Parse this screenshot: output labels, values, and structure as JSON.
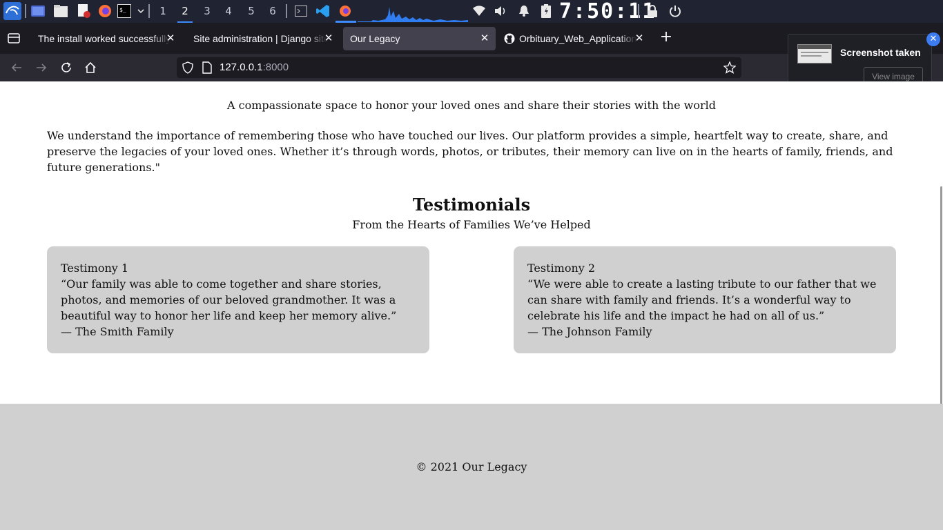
{
  "taskbar": {
    "workspaces": [
      "1",
      "2",
      "3",
      "4",
      "5",
      "6"
    ],
    "active_workspace": "2",
    "clock": "7:50:11",
    "icons": [
      "kali-menu-icon",
      "app-launcher-icon",
      "file-manager-icon",
      "text-editor-icon",
      "firefox-icon",
      "terminal-icon",
      "chevron-down-icon",
      "terminal-window-icon",
      "vscode-icon",
      "firefox-window-icon",
      "wifi-icon",
      "volume-icon",
      "bell-icon",
      "battery-icon",
      "lock-icon",
      "power-icon"
    ]
  },
  "browser": {
    "tabs": [
      {
        "label": "The install worked successfully! Congratulations!",
        "active": false
      },
      {
        "label": "Site administration | Django site admin",
        "active": false
      },
      {
        "label": "Our Legacy",
        "active": true
      },
      {
        "label": "Orbituary_Web_Application",
        "active": false
      }
    ],
    "url_host": "127.0.0.1",
    "url_port": ":8000"
  },
  "toast": {
    "title": "Screenshot taken",
    "button": "View image"
  },
  "page": {
    "tagline": "A compassionate space to honor your loved ones and share their stories with the world",
    "intro": "We understand the importance of remembering those who have touched our lives. Our platform provides a simple, heartfelt way to create, share, and preserve the legacies of your loved ones. Whether it’s through words, photos, or tributes, their memory can live on in the hearts of family, friends, and future generations.\"",
    "testimonials_title": "Testimonials",
    "testimonials_subtitle": "From the Hearts of Families We’ve Helped",
    "testimonials": [
      {
        "heading": "Testimony 1",
        "quote": "“Our family was able to come together and share stories, photos, and memories of our beloved grandmother. It was a beautiful way to honor her life and keep her memory alive.”",
        "author": "— The Smith Family"
      },
      {
        "heading": "Testimony 2",
        "quote": "“We were able to create a lasting tribute to our father that we can share with family and friends. It’s a wonderful way to celebrate his life and the impact he had on all of us.”",
        "author": "— The Johnson Family"
      }
    ],
    "footer": "© 2021 Our Legacy"
  },
  "colors": {
    "taskbar_bg": "#1f2332",
    "tabstrip_bg": "#1c1b22",
    "active_tab_bg": "#42414d",
    "toolbar_bg": "#2b2a33",
    "card_bg": "#d0d0d0",
    "footer_bg": "#d0d0d0",
    "accent": "#3d8bfd"
  }
}
